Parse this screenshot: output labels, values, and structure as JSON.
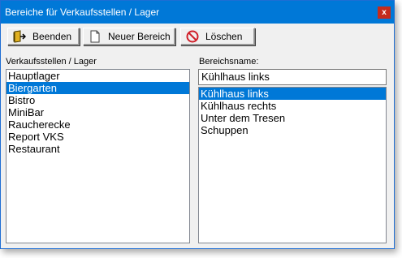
{
  "window": {
    "title": "Bereiche für Verkaufsstellen / Lager",
    "close_label": "x"
  },
  "toolbar": {
    "end_label": "Beenden",
    "new_label": "Neuer Bereich",
    "delete_label": "Löschen"
  },
  "left": {
    "label": "Verkaufsstellen / Lager",
    "items": [
      "Hauptlager",
      "Biergarten",
      "Bistro",
      "MiniBar",
      "Raucherecke",
      "Report VKS",
      "Restaurant"
    ],
    "selected_index": 1
  },
  "right": {
    "label": "Bereichsname:",
    "name_value": "Kühlhaus links",
    "items": [
      "Kühlhaus links",
      "Kühlhaus rechts",
      "Unter dem Tresen",
      "Schuppen"
    ],
    "selected_index": 0
  },
  "colors": {
    "titlebar": "#0078d7",
    "selection": "#0078d7",
    "close": "#c42b1c"
  },
  "icons": {
    "end": "exit-door-icon",
    "new": "new-document-icon",
    "delete": "no-entry-icon"
  }
}
